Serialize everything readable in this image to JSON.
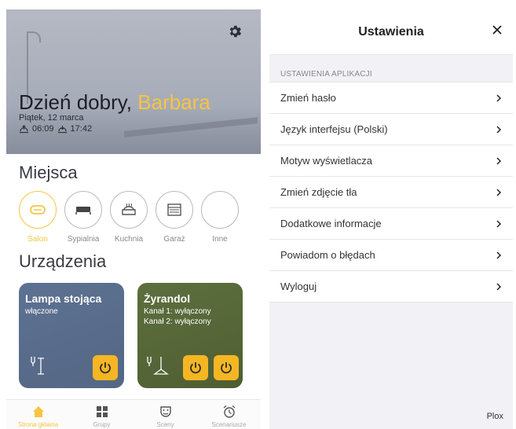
{
  "home": {
    "greeting_prefix": "Dzień dobry,",
    "user_name": "Barbara",
    "date": "Piątek, 12 marca",
    "sunrise": "06:09",
    "sunset": "17:42",
    "places_title": "Miejsca",
    "places": [
      {
        "label": "Salon",
        "icon": "sofa-icon",
        "active": true
      },
      {
        "label": "Sypialnia",
        "icon": "bed-icon",
        "active": false
      },
      {
        "label": "Kuchnia",
        "icon": "pot-icon",
        "active": false
      },
      {
        "label": "Garaż",
        "icon": "garage-icon",
        "active": false
      },
      {
        "label": "Inne",
        "icon": "",
        "active": false
      }
    ],
    "devices_title": "Urządzenia",
    "devices": [
      {
        "name": "Lampa stojąca",
        "status": "włączone"
      },
      {
        "name": "Żyrandol",
        "status": "Kanał 1: wyłączony\nKanał 2: wyłączony"
      }
    ],
    "tabs": [
      {
        "label": "Strona główna",
        "icon": "home-icon",
        "active": true
      },
      {
        "label": "Grupy",
        "icon": "grid-icon",
        "active": false
      },
      {
        "label": "Sceny",
        "icon": "masks-icon",
        "active": false
      },
      {
        "label": "Scenariusze",
        "icon": "alarm-clock-icon",
        "active": false
      }
    ],
    "accent_color": "#f5c542"
  },
  "settings": {
    "title": "Ustawienia",
    "group_label": "USTAWIENIA APLIKACJI",
    "items": [
      "Zmień hasło",
      "Język interfejsu (Polski)",
      "Motyw wyświetlacza",
      "Zmień zdjęcie tła",
      "Dodatkowe informacje",
      "Powiadom o błędach",
      "Wyloguj"
    ],
    "footer": "Plox"
  }
}
